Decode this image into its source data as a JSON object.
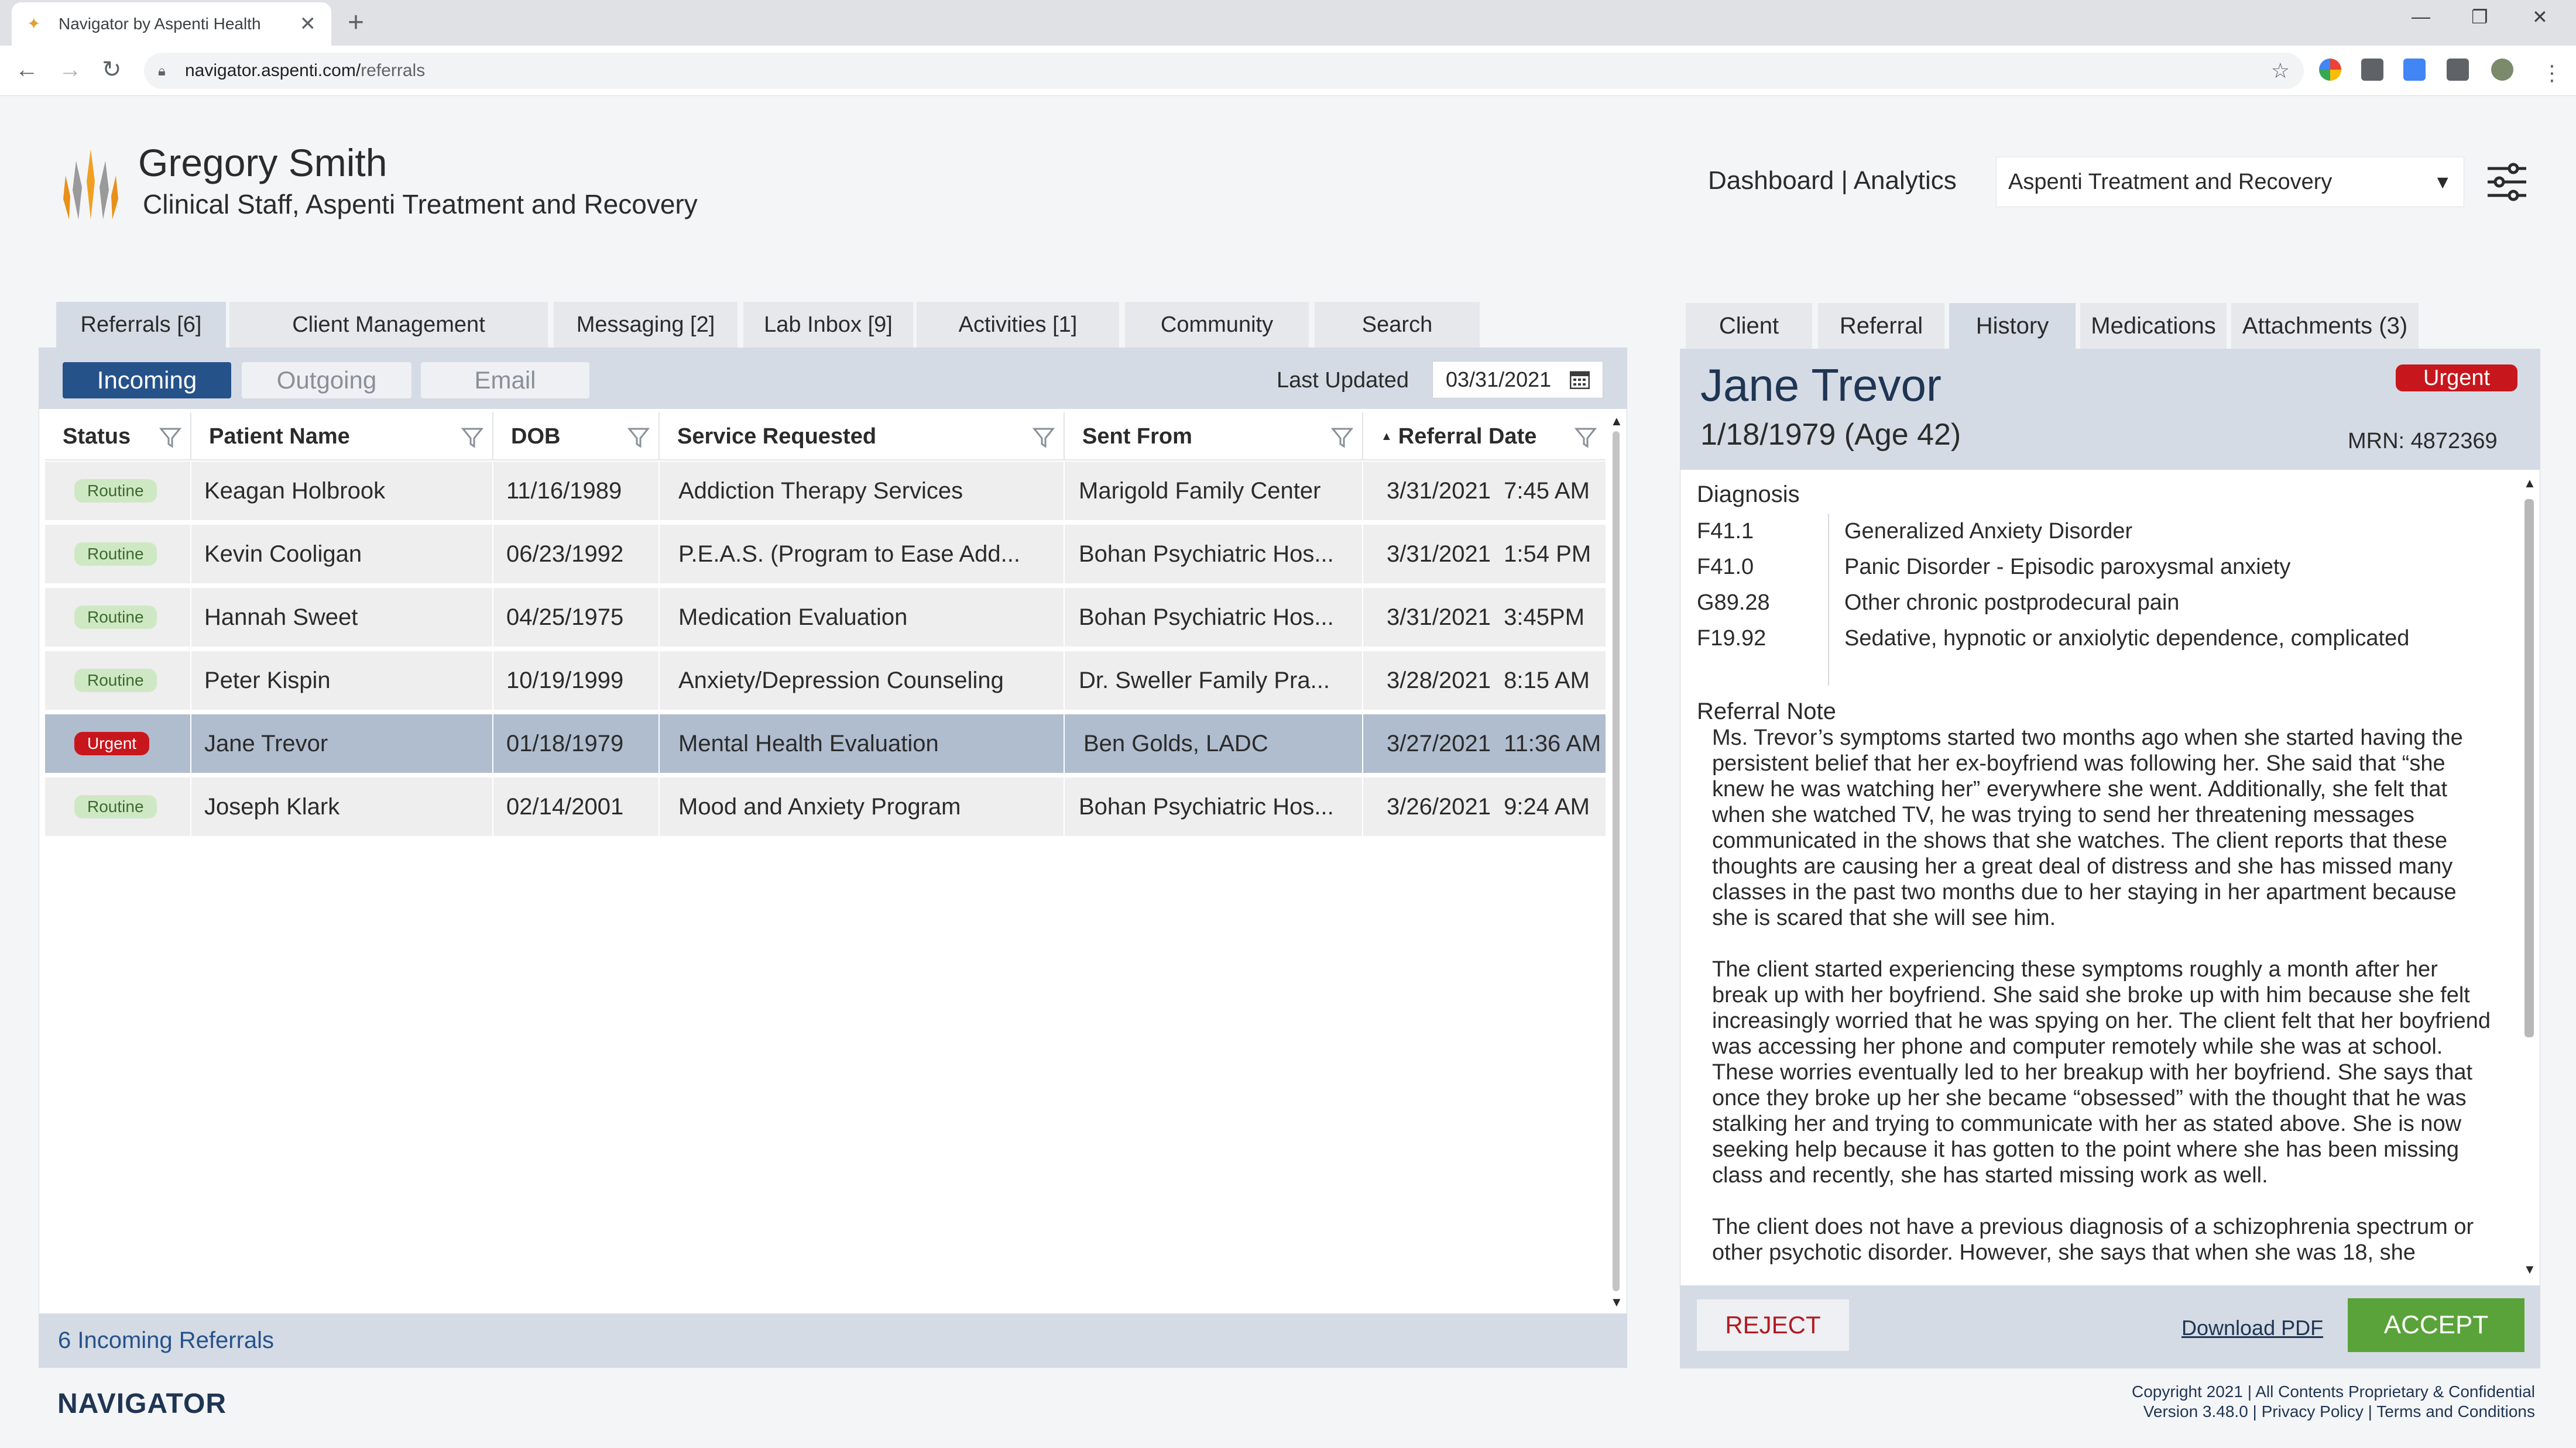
{
  "browser": {
    "tab_title": "Navigator by Aspenti Health",
    "new_tab": "+",
    "url_host": "navigator.aspenti.com/",
    "url_path": "referrals"
  },
  "header": {
    "user_name": "Gregory Smith",
    "user_role": "Clinical Staff, Aspenti Treatment and Recovery",
    "links": "Dashboard | Analytics",
    "org_select": "Aspenti Treatment and Recovery"
  },
  "main_tabs": [
    {
      "label": "Referrals [6]"
    },
    {
      "label": "Client Management"
    },
    {
      "label": "Messaging [2]"
    },
    {
      "label": "Lab Inbox [9]"
    },
    {
      "label": "Activities [1]"
    },
    {
      "label": "Community"
    },
    {
      "label": "Search"
    }
  ],
  "sub_tabs": [
    {
      "label": "Incoming"
    },
    {
      "label": "Outgoing"
    },
    {
      "label": "Email"
    }
  ],
  "last_updated": {
    "label": "Last Updated",
    "value": "03/31/2021"
  },
  "table": {
    "columns": [
      "Status",
      "Patient Name",
      "DOB",
      "Service Requested",
      "Sent From",
      "Referral Date"
    ],
    "sort_indicator": "▲",
    "rows": [
      {
        "status": "Routine",
        "name": "Keagan Holbrook",
        "dob": "11/16/1989",
        "service": "Addiction Therapy Services",
        "from": "Marigold Family Center",
        "date": "3/31/2021  7:45 AM"
      },
      {
        "status": "Routine",
        "name": "Kevin Cooligan",
        "dob": "06/23/1992",
        "service": "P.E.A.S. (Program to Ease Add...",
        "from": "Bohan Psychiatric Hos...",
        "date": "3/31/2021  1:54 PM"
      },
      {
        "status": "Routine",
        "name": "Hannah Sweet",
        "dob": "04/25/1975",
        "service": "Medication Evaluation",
        "from": "Bohan Psychiatric Hos...",
        "date": "3/31/2021  3:45PM"
      },
      {
        "status": "Routine",
        "name": "Peter Kispin",
        "dob": "10/19/1999",
        "service": "Anxiety/Depression Counseling",
        "from": "Dr. Sweller Family Pra...",
        "date": "3/28/2021  8:15 AM"
      },
      {
        "status": "Urgent",
        "name": "Jane Trevor",
        "dob": "01/18/1979",
        "service": "Mental Health Evaluation",
        "from": "Ben Golds, LADC",
        "date": "3/27/2021  11:36 AM"
      },
      {
        "status": "Routine",
        "name": "Joseph Klark",
        "dob": "02/14/2001",
        "service": "Mood and Anxiety Program",
        "from": "Bohan Psychiatric Hos...",
        "date": "3/26/2021  9:24 AM"
      }
    ]
  },
  "footer_count": "6 Incoming Referrals",
  "brand": "NAVIGATOR",
  "detail_tabs": [
    {
      "label": "Client"
    },
    {
      "label": "Referral"
    },
    {
      "label": "History"
    },
    {
      "label": "Medications"
    },
    {
      "label": "Attachments (3)"
    }
  ],
  "patient": {
    "name": "Jane Trevor",
    "dob_age": "1/18/1979 (Age 42)",
    "urgency": "Urgent",
    "mrn": "MRN: 4872369"
  },
  "diagnosis": {
    "heading": "Diagnosis",
    "items": [
      {
        "code": "F41.1",
        "desc": "Generalized Anxiety Disorder"
      },
      {
        "code": "F41.0",
        "desc": "Panic Disorder - Episodic paroxysmal anxiety"
      },
      {
        "code": "G89.28",
        "desc": "Other chronic postprodecural pain"
      },
      {
        "code": "F19.92",
        "desc": "Sedative, hypnotic or anxiolytic dependence, complicated"
      }
    ]
  },
  "referral_note": {
    "heading": "Referral Note",
    "p1": "Ms. Trevor’s symptoms started two months ago when she started having the persistent belief that her ex-boyfriend was following her. She said that “she knew he was watching her” everywhere she went. Additionally, she felt that when she watched TV, he was trying to send her threatening messages communicated in the shows that she watches. The client reports that these thoughts are causing her a great deal of distress and she has missed many classes in the past two months due to her staying in her apartment because she is scared that she will see him.",
    "p2": "The client started experiencing these symptoms roughly a month after her break up with her boyfriend. She said she broke up with him because she felt increasingly worried that he was spying on her. The client felt that her boyfriend was accessing her phone and computer remotely while she was at school. These worries eventually led to her breakup with her boyfriend. She says that once they broke up her she became “obsessed” with the thought that he was stalking her and trying to communicate with her as stated above. She is now seeking help because it has gotten to the point where she has been missing class and recently, she has started missing work as well.",
    "p3": "The client does not have a previous diagnosis of a schizophrenia spectrum or other psychotic disorder. However, she says that when she was 18, she"
  },
  "actions": {
    "reject": "REJECT",
    "download": "Download PDF",
    "accept": "ACCEPT"
  },
  "copyright": {
    "line1": "Copyright 2021 | All Contents Proprietary & Confidential",
    "line2": "Version 3.48.0 | Privacy Policy | Terms and Conditions"
  },
  "colors": {
    "accent": "#26528a",
    "urgent": "#c8161d",
    "routine_bg": "#cfe8c4",
    "accept": "#5aa33a"
  }
}
